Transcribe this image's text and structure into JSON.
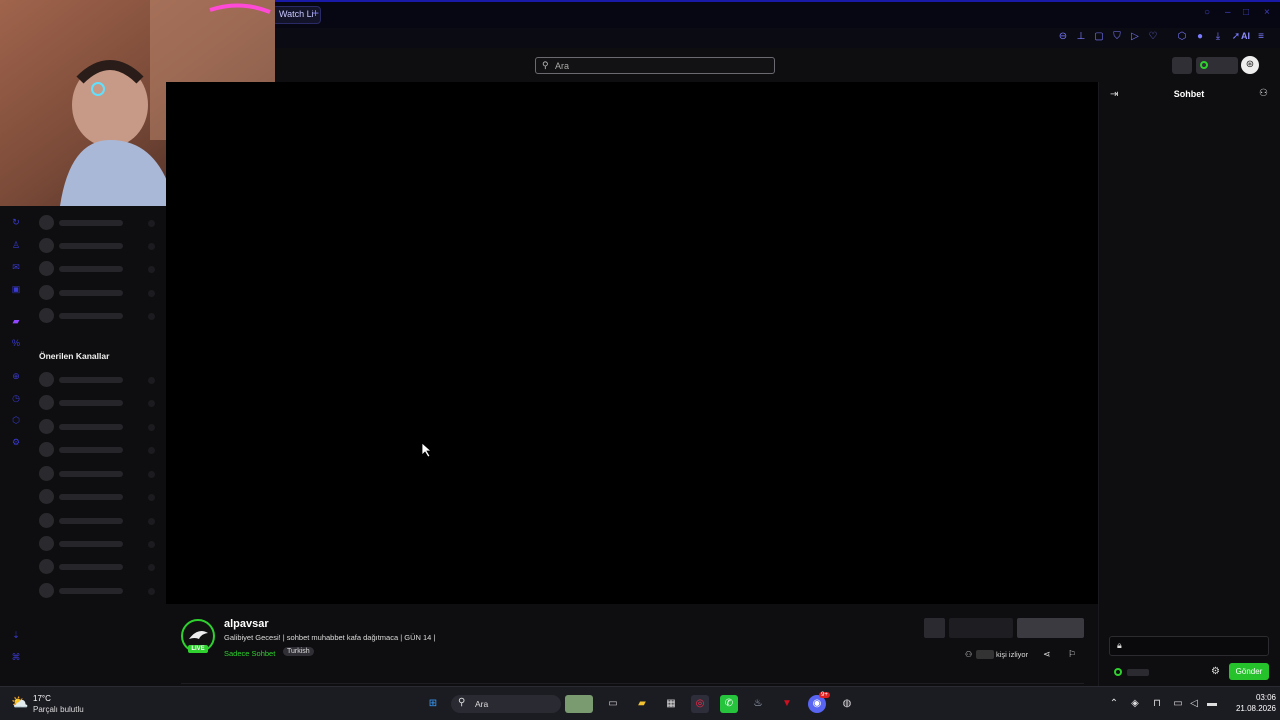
{
  "browser": {
    "tab_label": "Watch Li",
    "new_tab": "+",
    "ai_label": "AI"
  },
  "header": {
    "search_placeholder": "Ara"
  },
  "sidebar": {
    "recommended_title": "Önerilen Kanallar"
  },
  "chat": {
    "title": "Sohbet",
    "send_label": "Gönder"
  },
  "stream": {
    "channel": "alpavsar",
    "title": "Galibiyet Gecesi! | sohbet muhabbet kafa dağıtmaca | GÜN 14 |",
    "category": "Sadece Sohbet",
    "language": "Turkish",
    "live_badge": "LIVE",
    "viewers_label": "kişi izliyor"
  },
  "taskbar": {
    "temperature": "17°C",
    "weather": "Parçalı bulutlu",
    "search_label": "Ara",
    "time": "03:06",
    "date": "21.08.2026",
    "discord_badge": "9+"
  },
  "colors": {
    "accent_blue": "#3a3ad0",
    "live_green": "#2ed12e"
  }
}
